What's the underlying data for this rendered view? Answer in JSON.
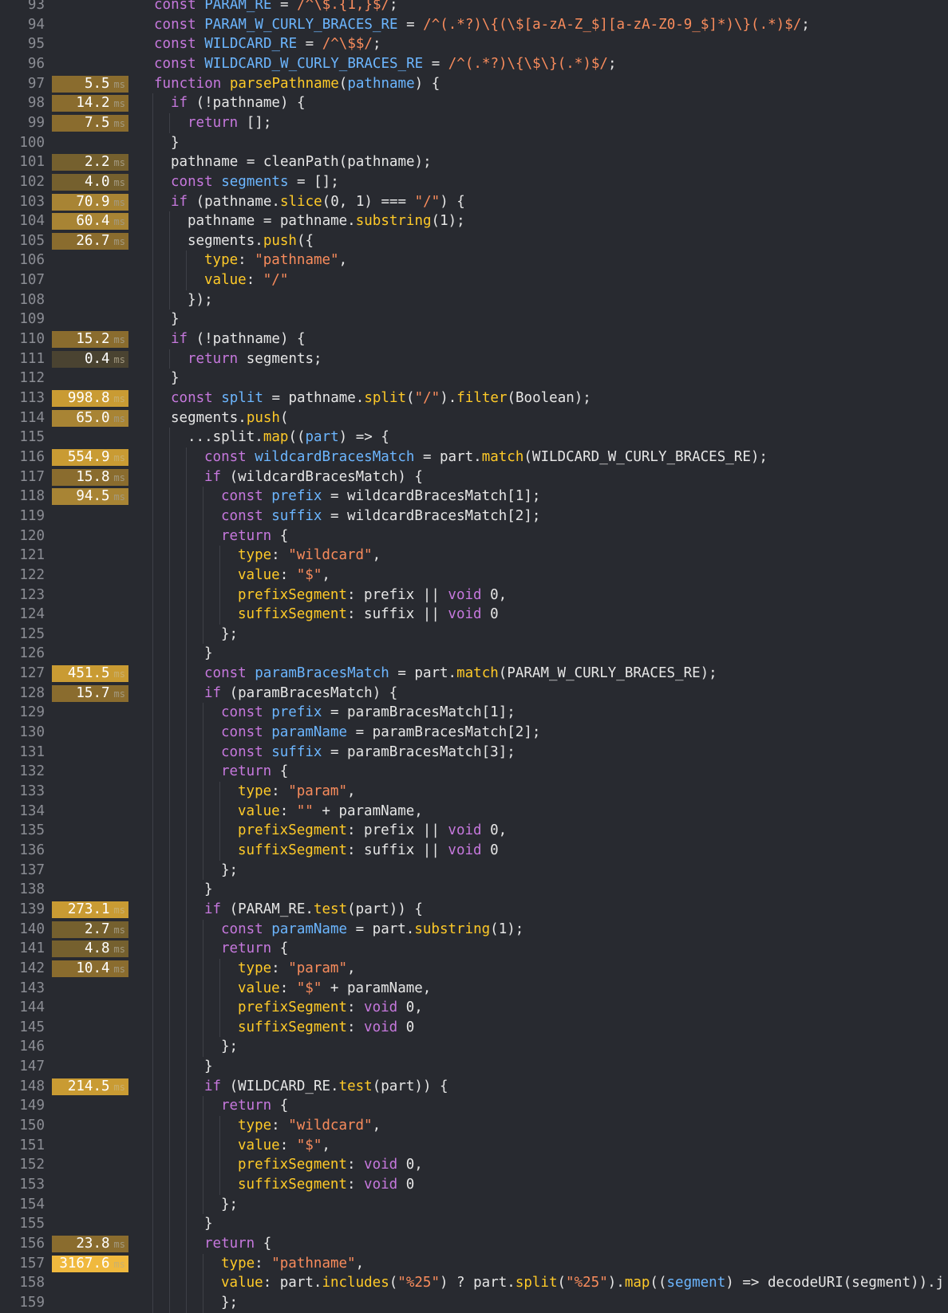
{
  "lines": [
    {
      "n": "93",
      "ms": null,
      "ind": 0,
      "code": [
        [
          "k",
          "const "
        ],
        [
          "v",
          "PARAM_RE"
        ],
        [
          "t",
          " = "
        ],
        [
          "s",
          "/^\\$.{1,}$/"
        ],
        [
          "t",
          ";"
        ]
      ]
    },
    {
      "n": "94",
      "ms": null,
      "ind": 0,
      "code": [
        [
          "k",
          "const "
        ],
        [
          "v",
          "PARAM_W_CURLY_BRACES_RE"
        ],
        [
          "t",
          " = "
        ],
        [
          "s",
          "/^(.*?)\\{(\\$[a-zA-Z_$][a-zA-Z0-9_$]*)\\}(.*)$/"
        ],
        [
          "t",
          ";"
        ]
      ]
    },
    {
      "n": "95",
      "ms": null,
      "ind": 0,
      "code": [
        [
          "k",
          "const "
        ],
        [
          "v",
          "WILDCARD_RE"
        ],
        [
          "t",
          " = "
        ],
        [
          "s",
          "/^\\$$/"
        ],
        [
          "t",
          ";"
        ]
      ]
    },
    {
      "n": "96",
      "ms": null,
      "ind": 0,
      "code": [
        [
          "k",
          "const "
        ],
        [
          "v",
          "WILDCARD_W_CURLY_BRACES_RE"
        ],
        [
          "t",
          " = "
        ],
        [
          "s",
          "/^(.*?)\\{\\$\\}(.*)$/"
        ],
        [
          "t",
          ";"
        ]
      ]
    },
    {
      "n": "97",
      "ms": "5.5",
      "ind": 0,
      "code": [
        [
          "k",
          "function "
        ],
        [
          "f",
          "parsePathname"
        ],
        [
          "t",
          "("
        ],
        [
          "v",
          "pathname"
        ],
        [
          "t",
          ") {"
        ]
      ]
    },
    {
      "n": "98",
      "ms": "14.2",
      "ind": 1,
      "code": [
        [
          "k",
          "if "
        ],
        [
          "t",
          "(!pathname) {"
        ]
      ]
    },
    {
      "n": "99",
      "ms": "7.5",
      "ind": 2,
      "code": [
        [
          "k",
          "return "
        ],
        [
          "t",
          "[];"
        ]
      ]
    },
    {
      "n": "100",
      "ms": null,
      "ind": 1,
      "code": [
        [
          "t",
          "}"
        ]
      ]
    },
    {
      "n": "101",
      "ms": "2.2",
      "ind": 1,
      "code": [
        [
          "t",
          "pathname = cleanPath(pathname);"
        ]
      ]
    },
    {
      "n": "102",
      "ms": "4.0",
      "ind": 1,
      "code": [
        [
          "k",
          "const "
        ],
        [
          "v",
          "segments"
        ],
        [
          "t",
          " = [];"
        ]
      ]
    },
    {
      "n": "103",
      "ms": "70.9",
      "ind": 1,
      "code": [
        [
          "k",
          "if "
        ],
        [
          "t",
          "(pathname."
        ],
        [
          "f",
          "slice"
        ],
        [
          "t",
          "("
        ],
        [
          "n",
          "0"
        ],
        [
          "t",
          ", "
        ],
        [
          "n",
          "1"
        ],
        [
          "t",
          ") === "
        ],
        [
          "s",
          "\"/\""
        ],
        [
          "t",
          ") {"
        ]
      ]
    },
    {
      "n": "104",
      "ms": "60.4",
      "ind": 2,
      "code": [
        [
          "t",
          "pathname = pathname."
        ],
        [
          "f",
          "substring"
        ],
        [
          "t",
          "("
        ],
        [
          "n",
          "1"
        ],
        [
          "t",
          ");"
        ]
      ]
    },
    {
      "n": "105",
      "ms": "26.7",
      "ind": 2,
      "code": [
        [
          "t",
          "segments."
        ],
        [
          "f",
          "push"
        ],
        [
          "t",
          "({"
        ]
      ]
    },
    {
      "n": "106",
      "ms": null,
      "ind": 3,
      "code": [
        [
          "p",
          "type"
        ],
        [
          "t",
          ": "
        ],
        [
          "s",
          "\"pathname\""
        ],
        [
          "t",
          ","
        ]
      ]
    },
    {
      "n": "107",
      "ms": null,
      "ind": 3,
      "code": [
        [
          "p",
          "value"
        ],
        [
          "t",
          ": "
        ],
        [
          "s",
          "\"/\""
        ]
      ]
    },
    {
      "n": "108",
      "ms": null,
      "ind": 2,
      "code": [
        [
          "t",
          "});"
        ]
      ]
    },
    {
      "n": "109",
      "ms": null,
      "ind": 1,
      "code": [
        [
          "t",
          "}"
        ]
      ]
    },
    {
      "n": "110",
      "ms": "15.2",
      "ind": 1,
      "code": [
        [
          "k",
          "if "
        ],
        [
          "t",
          "(!pathname) {"
        ]
      ]
    },
    {
      "n": "111",
      "ms": "0.4",
      "ind": 2,
      "code": [
        [
          "k",
          "return "
        ],
        [
          "t",
          "segments;"
        ]
      ]
    },
    {
      "n": "112",
      "ms": null,
      "ind": 1,
      "code": [
        [
          "t",
          "}"
        ]
      ]
    },
    {
      "n": "113",
      "ms": "998.8",
      "ind": 1,
      "code": [
        [
          "k",
          "const "
        ],
        [
          "v",
          "split"
        ],
        [
          "t",
          " = pathname."
        ],
        [
          "f",
          "split"
        ],
        [
          "t",
          "("
        ],
        [
          "s",
          "\"/\""
        ],
        [
          "t",
          ")."
        ],
        [
          "f",
          "filter"
        ],
        [
          "t",
          "(Boolean);"
        ]
      ]
    },
    {
      "n": "114",
      "ms": "65.0",
      "ind": 1,
      "code": [
        [
          "t",
          "segments."
        ],
        [
          "f",
          "push"
        ],
        [
          "t",
          "("
        ]
      ]
    },
    {
      "n": "115",
      "ms": null,
      "ind": 2,
      "code": [
        [
          "t",
          "...split."
        ],
        [
          "f",
          "map"
        ],
        [
          "t",
          "(("
        ],
        [
          "v",
          "part"
        ],
        [
          "t",
          ") => {"
        ]
      ]
    },
    {
      "n": "116",
      "ms": "554.9",
      "ind": 3,
      "code": [
        [
          "k",
          "const "
        ],
        [
          "v",
          "wildcardBracesMatch"
        ],
        [
          "t",
          " = part."
        ],
        [
          "f",
          "match"
        ],
        [
          "t",
          "(WILDCARD_W_CURLY_BRACES_RE);"
        ]
      ]
    },
    {
      "n": "117",
      "ms": "15.8",
      "ind": 3,
      "code": [
        [
          "k",
          "if "
        ],
        [
          "t",
          "(wildcardBracesMatch) {"
        ]
      ]
    },
    {
      "n": "118",
      "ms": "94.5",
      "ind": 4,
      "code": [
        [
          "k",
          "const "
        ],
        [
          "v",
          "prefix"
        ],
        [
          "t",
          " = wildcardBracesMatch["
        ],
        [
          "n",
          "1"
        ],
        [
          "t",
          "];"
        ]
      ]
    },
    {
      "n": "119",
      "ms": null,
      "ind": 4,
      "code": [
        [
          "k",
          "const "
        ],
        [
          "v",
          "suffix"
        ],
        [
          "t",
          " = wildcardBracesMatch["
        ],
        [
          "n",
          "2"
        ],
        [
          "t",
          "];"
        ]
      ]
    },
    {
      "n": "120",
      "ms": null,
      "ind": 4,
      "code": [
        [
          "k",
          "return "
        ],
        [
          "t",
          "{"
        ]
      ]
    },
    {
      "n": "121",
      "ms": null,
      "ind": 5,
      "code": [
        [
          "p",
          "type"
        ],
        [
          "t",
          ": "
        ],
        [
          "s",
          "\"wildcard\""
        ],
        [
          "t",
          ","
        ]
      ]
    },
    {
      "n": "122",
      "ms": null,
      "ind": 5,
      "code": [
        [
          "p",
          "value"
        ],
        [
          "t",
          ": "
        ],
        [
          "s",
          "\"$\""
        ],
        [
          "t",
          ","
        ]
      ]
    },
    {
      "n": "123",
      "ms": null,
      "ind": 5,
      "code": [
        [
          "p",
          "prefixSegment"
        ],
        [
          "t",
          ": prefix || "
        ],
        [
          "k",
          "void "
        ],
        [
          "n",
          "0"
        ],
        [
          "t",
          ","
        ]
      ]
    },
    {
      "n": "124",
      "ms": null,
      "ind": 5,
      "code": [
        [
          "p",
          "suffixSegment"
        ],
        [
          "t",
          ": suffix || "
        ],
        [
          "k",
          "void "
        ],
        [
          "n",
          "0"
        ]
      ]
    },
    {
      "n": "125",
      "ms": null,
      "ind": 4,
      "code": [
        [
          "t",
          "};"
        ]
      ]
    },
    {
      "n": "126",
      "ms": null,
      "ind": 3,
      "code": [
        [
          "t",
          "}"
        ]
      ]
    },
    {
      "n": "127",
      "ms": "451.5",
      "ind": 3,
      "code": [
        [
          "k",
          "const "
        ],
        [
          "v",
          "paramBracesMatch"
        ],
        [
          "t",
          " = part."
        ],
        [
          "f",
          "match"
        ],
        [
          "t",
          "(PARAM_W_CURLY_BRACES_RE);"
        ]
      ]
    },
    {
      "n": "128",
      "ms": "15.7",
      "ind": 3,
      "code": [
        [
          "k",
          "if "
        ],
        [
          "t",
          "(paramBracesMatch) {"
        ]
      ]
    },
    {
      "n": "129",
      "ms": null,
      "ind": 4,
      "code": [
        [
          "k",
          "const "
        ],
        [
          "v",
          "prefix"
        ],
        [
          "t",
          " = paramBracesMatch["
        ],
        [
          "n",
          "1"
        ],
        [
          "t",
          "];"
        ]
      ]
    },
    {
      "n": "130",
      "ms": null,
      "ind": 4,
      "code": [
        [
          "k",
          "const "
        ],
        [
          "v",
          "paramName"
        ],
        [
          "t",
          " = paramBracesMatch["
        ],
        [
          "n",
          "2"
        ],
        [
          "t",
          "];"
        ]
      ]
    },
    {
      "n": "131",
      "ms": null,
      "ind": 4,
      "code": [
        [
          "k",
          "const "
        ],
        [
          "v",
          "suffix"
        ],
        [
          "t",
          " = paramBracesMatch["
        ],
        [
          "n",
          "3"
        ],
        [
          "t",
          "];"
        ]
      ]
    },
    {
      "n": "132",
      "ms": null,
      "ind": 4,
      "code": [
        [
          "k",
          "return "
        ],
        [
          "t",
          "{"
        ]
      ]
    },
    {
      "n": "133",
      "ms": null,
      "ind": 5,
      "code": [
        [
          "p",
          "type"
        ],
        [
          "t",
          ": "
        ],
        [
          "s",
          "\"param\""
        ],
        [
          "t",
          ","
        ]
      ]
    },
    {
      "n": "134",
      "ms": null,
      "ind": 5,
      "code": [
        [
          "p",
          "value"
        ],
        [
          "t",
          ": "
        ],
        [
          "s",
          "\"\""
        ],
        [
          "t",
          " + paramName,"
        ]
      ]
    },
    {
      "n": "135",
      "ms": null,
      "ind": 5,
      "code": [
        [
          "p",
          "prefixSegment"
        ],
        [
          "t",
          ": prefix || "
        ],
        [
          "k",
          "void "
        ],
        [
          "n",
          "0"
        ],
        [
          "t",
          ","
        ]
      ]
    },
    {
      "n": "136",
      "ms": null,
      "ind": 5,
      "code": [
        [
          "p",
          "suffixSegment"
        ],
        [
          "t",
          ": suffix || "
        ],
        [
          "k",
          "void "
        ],
        [
          "n",
          "0"
        ]
      ]
    },
    {
      "n": "137",
      "ms": null,
      "ind": 4,
      "code": [
        [
          "t",
          "};"
        ]
      ]
    },
    {
      "n": "138",
      "ms": null,
      "ind": 3,
      "code": [
        [
          "t",
          "}"
        ]
      ]
    },
    {
      "n": "139",
      "ms": "273.1",
      "ind": 3,
      "code": [
        [
          "k",
          "if "
        ],
        [
          "t",
          "(PARAM_RE."
        ],
        [
          "f",
          "test"
        ],
        [
          "t",
          "(part)) {"
        ]
      ]
    },
    {
      "n": "140",
      "ms": "2.7",
      "ind": 4,
      "code": [
        [
          "k",
          "const "
        ],
        [
          "v",
          "paramName"
        ],
        [
          "t",
          " = part."
        ],
        [
          "f",
          "substring"
        ],
        [
          "t",
          "("
        ],
        [
          "n",
          "1"
        ],
        [
          "t",
          ");"
        ]
      ]
    },
    {
      "n": "141",
      "ms": "4.8",
      "ind": 4,
      "code": [
        [
          "k",
          "return "
        ],
        [
          "t",
          "{"
        ]
      ]
    },
    {
      "n": "142",
      "ms": "10.4",
      "ind": 5,
      "code": [
        [
          "p",
          "type"
        ],
        [
          "t",
          ": "
        ],
        [
          "s",
          "\"param\""
        ],
        [
          "t",
          ","
        ]
      ]
    },
    {
      "n": "143",
      "ms": null,
      "ind": 5,
      "code": [
        [
          "p",
          "value"
        ],
        [
          "t",
          ": "
        ],
        [
          "s",
          "\"$\""
        ],
        [
          "t",
          " + paramName,"
        ]
      ]
    },
    {
      "n": "144",
      "ms": null,
      "ind": 5,
      "code": [
        [
          "p",
          "prefixSegment"
        ],
        [
          "t",
          ": "
        ],
        [
          "k",
          "void "
        ],
        [
          "n",
          "0"
        ],
        [
          "t",
          ","
        ]
      ]
    },
    {
      "n": "145",
      "ms": null,
      "ind": 5,
      "code": [
        [
          "p",
          "suffixSegment"
        ],
        [
          "t",
          ": "
        ],
        [
          "k",
          "void "
        ],
        [
          "n",
          "0"
        ]
      ]
    },
    {
      "n": "146",
      "ms": null,
      "ind": 4,
      "code": [
        [
          "t",
          "};"
        ]
      ]
    },
    {
      "n": "147",
      "ms": null,
      "ind": 3,
      "code": [
        [
          "t",
          "}"
        ]
      ]
    },
    {
      "n": "148",
      "ms": "214.5",
      "ind": 3,
      "code": [
        [
          "k",
          "if "
        ],
        [
          "t",
          "(WILDCARD_RE."
        ],
        [
          "f",
          "test"
        ],
        [
          "t",
          "(part)) {"
        ]
      ]
    },
    {
      "n": "149",
      "ms": null,
      "ind": 4,
      "code": [
        [
          "k",
          "return "
        ],
        [
          "t",
          "{"
        ]
      ]
    },
    {
      "n": "150",
      "ms": null,
      "ind": 5,
      "code": [
        [
          "p",
          "type"
        ],
        [
          "t",
          ": "
        ],
        [
          "s",
          "\"wildcard\""
        ],
        [
          "t",
          ","
        ]
      ]
    },
    {
      "n": "151",
      "ms": null,
      "ind": 5,
      "code": [
        [
          "p",
          "value"
        ],
        [
          "t",
          ": "
        ],
        [
          "s",
          "\"$\""
        ],
        [
          "t",
          ","
        ]
      ]
    },
    {
      "n": "152",
      "ms": null,
      "ind": 5,
      "code": [
        [
          "p",
          "prefixSegment"
        ],
        [
          "t",
          ": "
        ],
        [
          "k",
          "void "
        ],
        [
          "n",
          "0"
        ],
        [
          "t",
          ","
        ]
      ]
    },
    {
      "n": "153",
      "ms": null,
      "ind": 5,
      "code": [
        [
          "p",
          "suffixSegment"
        ],
        [
          "t",
          ": "
        ],
        [
          "k",
          "void "
        ],
        [
          "n",
          "0"
        ]
      ]
    },
    {
      "n": "154",
      "ms": null,
      "ind": 4,
      "code": [
        [
          "t",
          "};"
        ]
      ]
    },
    {
      "n": "155",
      "ms": null,
      "ind": 3,
      "code": [
        [
          "t",
          "}"
        ]
      ]
    },
    {
      "n": "156",
      "ms": "23.8",
      "ind": 3,
      "code": [
        [
          "k",
          "return "
        ],
        [
          "t",
          "{"
        ]
      ]
    },
    {
      "n": "157",
      "ms": "3167.6",
      "ind": 4,
      "code": [
        [
          "p",
          "type"
        ],
        [
          "t",
          ": "
        ],
        [
          "s",
          "\"pathname\""
        ],
        [
          "t",
          ","
        ]
      ]
    },
    {
      "n": "158",
      "ms": null,
      "ind": 4,
      "code": [
        [
          "p",
          "value"
        ],
        [
          "t",
          ": part."
        ],
        [
          "f",
          "includes"
        ],
        [
          "t",
          "("
        ],
        [
          "s",
          "\"%25\""
        ],
        [
          "t",
          ") ? part."
        ],
        [
          "f",
          "split"
        ],
        [
          "t",
          "("
        ],
        [
          "s",
          "\"%25\""
        ],
        [
          "t",
          ")."
        ],
        [
          "f",
          "map"
        ],
        [
          "t",
          "(("
        ],
        [
          "v",
          "segment"
        ],
        [
          "t",
          ") => decodeURI(segment)).j"
        ]
      ]
    },
    {
      "n": "159",
      "ms": null,
      "ind": 4,
      "code": [
        [
          "t",
          "};"
        ]
      ]
    }
  ]
}
